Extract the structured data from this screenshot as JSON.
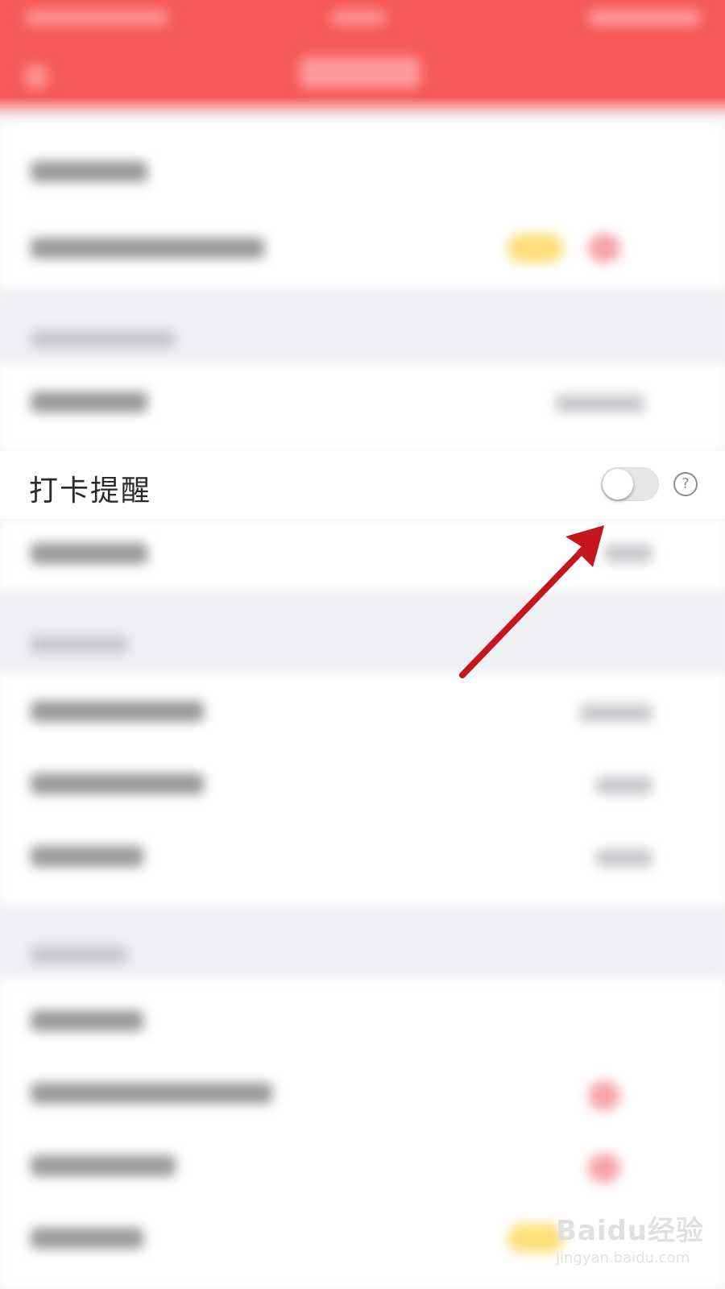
{
  "setting_row": {
    "label": "打卡提醒",
    "toggle_state": "off",
    "help_glyph": "?"
  },
  "watermark": {
    "brand": "Baidu经验",
    "url": "jingyan.baidu.com"
  },
  "colors": {
    "header": "#f65a5a",
    "arrow": "#c4161c",
    "toggle_track": "#e6e6e6",
    "background": "#f4f4f6"
  },
  "icons": {
    "help": "question-circle-icon",
    "toggle": "toggle-switch-off",
    "arrow": "red-annotation-arrow"
  }
}
